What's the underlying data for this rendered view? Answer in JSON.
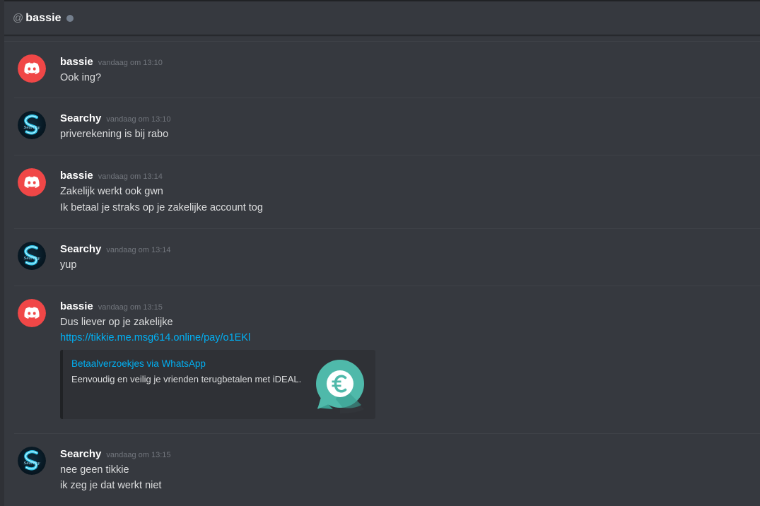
{
  "header": {
    "at_symbol": "@",
    "channel_name": "bassie",
    "status": "offline"
  },
  "messages": [
    {
      "author": "bassie",
      "avatar_icon": "discord-logo-icon",
      "timestamp": "vandaag om 13:10",
      "lines": [
        "Ook ing?"
      ]
    },
    {
      "author": "Searchy",
      "avatar_icon": "searchy-s-logo-icon",
      "timestamp": "vandaag om 13:10",
      "lines": [
        "priverekening is bij rabo"
      ]
    },
    {
      "author": "bassie",
      "avatar_icon": "discord-logo-icon",
      "timestamp": "vandaag om 13:14",
      "lines": [
        "Zakelijk werkt ook gwn",
        "Ik betaal je straks op je zakelijke account tog"
      ]
    },
    {
      "author": "Searchy",
      "avatar_icon": "searchy-s-logo-icon",
      "timestamp": "vandaag om 13:14",
      "lines": [
        "yup"
      ]
    },
    {
      "author": "bassie",
      "avatar_icon": "discord-logo-icon",
      "timestamp": "vandaag om 13:15",
      "lines": [
        "Dus liever op je zakelijke"
      ],
      "link": "https://tikkie.me.msg614.online/pay/o1EKl",
      "embed": {
        "title": "Betaalverzoekjes via WhatsApp",
        "description": "Eenvoudig en veilig je vrienden terugbetalen met iDEAL.",
        "thumbnail_icon": "tikkie-euro-bubble-icon"
      }
    },
    {
      "author": "Searchy",
      "avatar_icon": "searchy-s-logo-icon",
      "timestamp": "vandaag om 13:15",
      "lines": [
        "nee geen tikkie",
        "ik zeg je dat werkt niet"
      ]
    }
  ],
  "colors": {
    "background": "#36393f",
    "discord_avatar": "#f04747",
    "link": "#00b0f4",
    "embed_bg": "#2f3136",
    "tikkie_teal": "#4fb9aa"
  }
}
